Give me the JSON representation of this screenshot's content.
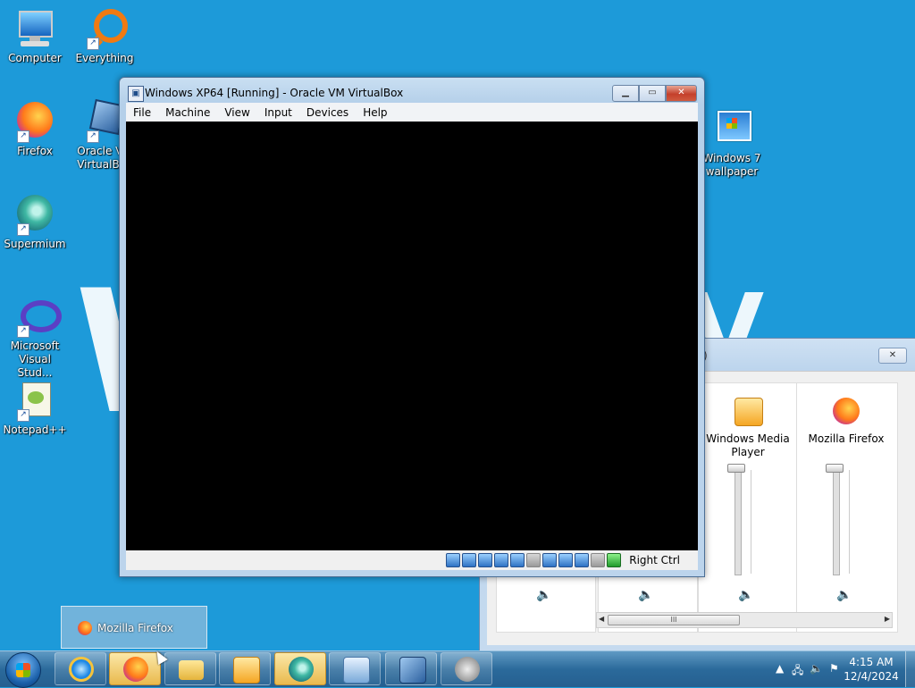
{
  "desktop": {
    "icons": [
      {
        "label": "Computer"
      },
      {
        "label": "Everything"
      },
      {
        "label": "Firefox"
      },
      {
        "label": "Oracle VM VirtualBox"
      },
      {
        "label": "Supermium"
      },
      {
        "label": "Microsoft Visual Stud..."
      },
      {
        "label": "Notepad++"
      },
      {
        "label": "Windows 7 wallpaper"
      }
    ]
  },
  "vbox": {
    "title": "Windows XP64 [Running] - Oracle VM VirtualBox",
    "menu": [
      "File",
      "Machine",
      "View",
      "Input",
      "Devices",
      "Help"
    ],
    "host_key": "Right Ctrl"
  },
  "mixer": {
    "title_fragment": ")",
    "apps": [
      {
        "label": "Windows Media Player"
      },
      {
        "label": "Mozilla Firefox"
      }
    ],
    "scroll_grip": "III"
  },
  "taskbar": {
    "thumbnail_label": "Mozilla Firefox",
    "clock_time": "4:15 AM",
    "clock_date": "12/4/2024"
  },
  "colors": {
    "desktop_bg": "#1d9ad9",
    "vm_screen": "#000000",
    "close_button": "#c4402b"
  }
}
